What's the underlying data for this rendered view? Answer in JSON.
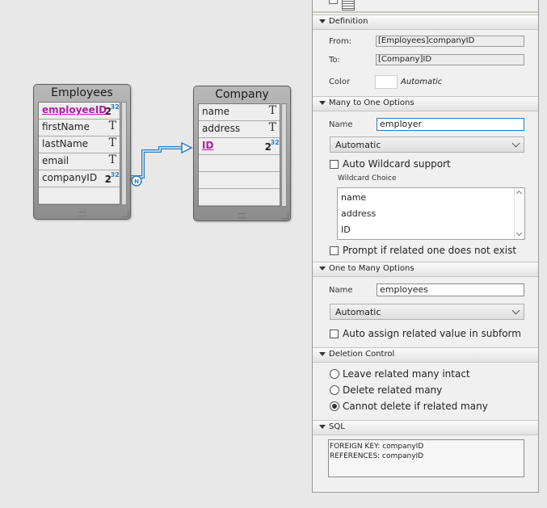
{
  "employees_table": {
    "title": "Employees",
    "fields": [
      {
        "name": "employeeID",
        "type": "number-icon",
        "pk": true
      },
      {
        "name": "firstName",
        "type": "text-icon"
      },
      {
        "name": "lastName",
        "type": "text-icon"
      },
      {
        "name": "email",
        "type": "text-icon"
      },
      {
        "name": "companyID",
        "type": "number-icon"
      }
    ]
  },
  "company_table": {
    "title": "Company",
    "fields": [
      {
        "name": "name",
        "type": "text-icon"
      },
      {
        "name": "address",
        "type": "text-icon"
      },
      {
        "name": "ID",
        "type": "number-icon",
        "pk": true
      }
    ]
  },
  "icons": {
    "text_glyph": "T",
    "num_base": "2",
    "num_sup": "32",
    "relation_badge": "N"
  },
  "colors": {
    "primary_key": "#b0209f",
    "relation_line": "#2f78b8",
    "focus_border": "#2f78b8"
  },
  "panel": {
    "definition": {
      "title": "Definition",
      "from_label": "From:",
      "from_value": "[Employees]companyID",
      "to_label": "To:",
      "to_value": "[Company]ID",
      "color_label": "Color",
      "color_value": "Automatic"
    },
    "many_to_one": {
      "title": "Many to One Options",
      "name_label": "Name",
      "name_value": "employer",
      "select_value": "Automatic",
      "wildcard_checkbox": "Auto Wildcard support",
      "wildcard_choice_label": "Wildcard Choice",
      "wildcard_items": [
        "name",
        "address",
        "ID"
      ],
      "prompt_checkbox": "Prompt if related one does not exist"
    },
    "one_to_many": {
      "title": "One to Many Options",
      "name_label": "Name",
      "name_value": "employees",
      "select_value": "Automatic",
      "assign_checkbox": "Auto assign related value in subform"
    },
    "deletion": {
      "title": "Deletion Control",
      "options": [
        "Leave related many intact",
        "Delete related many",
        "Cannot delete if related many"
      ],
      "selected_index": 2
    },
    "sql": {
      "title": "SQL",
      "text": "FOREIGN KEY: companyID\nREFERENCES: companyID"
    }
  }
}
